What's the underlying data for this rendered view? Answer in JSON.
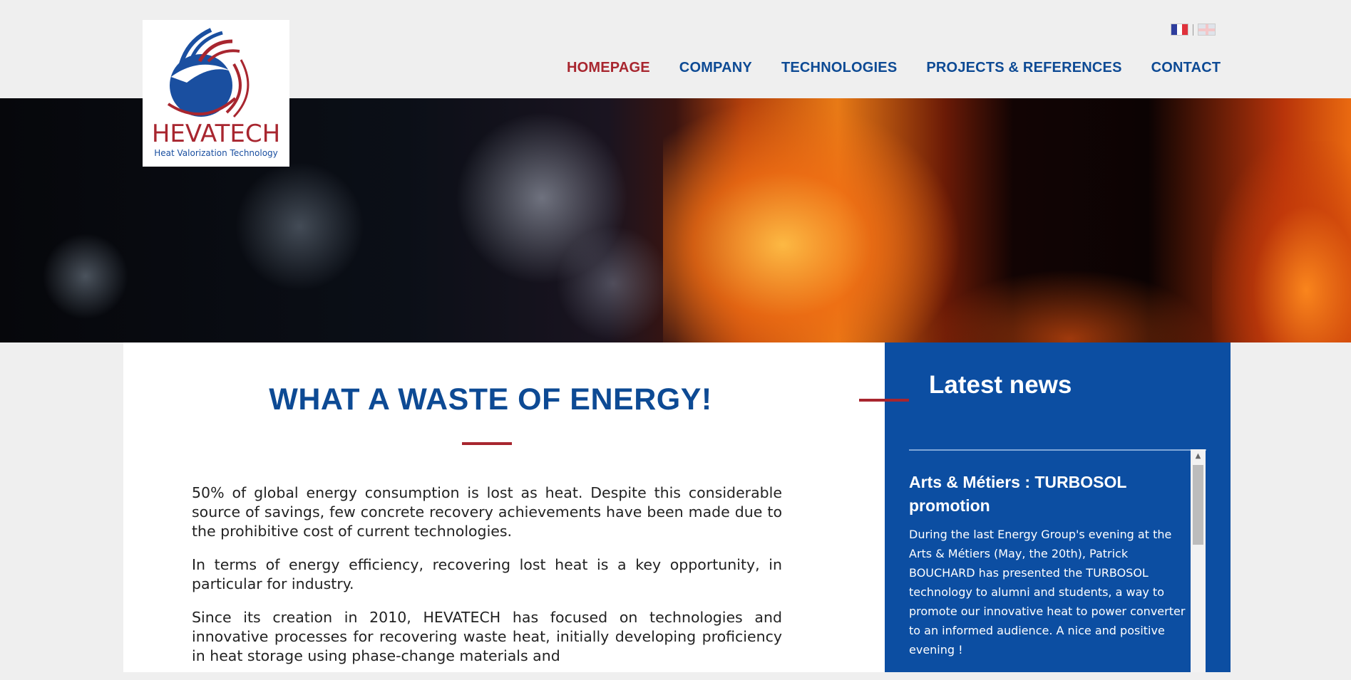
{
  "brand": {
    "name": "HEVATECH",
    "tagline": "Heat Valorization Technology",
    "colors": {
      "blue": "#0d4a94",
      "red": "#a8262f",
      "news_bg": "#0c4ea2"
    }
  },
  "languages": [
    {
      "code": "fr",
      "icon": "france-flag-icon"
    },
    {
      "code": "en",
      "icon": "uk-flag-icon"
    }
  ],
  "nav": {
    "items": [
      {
        "label": "HOMEPAGE",
        "active": true
      },
      {
        "label": "COMPANY"
      },
      {
        "label": "TECHNOLOGIES"
      },
      {
        "label": "PROJECTS & REFERENCES"
      },
      {
        "label": "CONTACT"
      }
    ]
  },
  "main": {
    "title": "WHAT A WASTE OF ENERGY!",
    "paragraphs": [
      "50% of global energy consumption is lost as heat. Despite this considerable source of savings, few concrete recovery achievements have been made due to the prohibitive cost of current technologies.",
      "In terms of energy efficiency, recovering lost heat is a key opportunity, in particular for industry.",
      "Since its creation in 2010, HEVATECH has focused on technologies and innovative processes for recovering waste heat, initially developing proficiency in heat storage using phase-change materials and"
    ]
  },
  "news": {
    "title": "Latest news",
    "article": {
      "title": "Arts & Métiers : TURBOSOL promotion",
      "body": "During the last Energy Group's evening at the Arts & Métiers (May, the 20th), Patrick BOUCHARD has presented the TURBOSOL technology to alumni and students, a way to promote our innovative heat to power converter to an informed audience. A nice and positive evening !"
    }
  }
}
